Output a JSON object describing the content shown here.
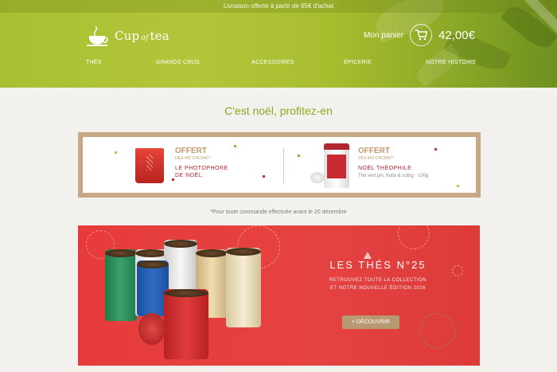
{
  "topbar": {
    "text": "Livraison offerte à partir de 65€ d'achat"
  },
  "corner_ribbon": "",
  "header": {
    "logo": {
      "name": "Cup",
      "connector": "of",
      "tea": "tea"
    },
    "cart": {
      "label": "Mon panier",
      "total": "42,00€"
    }
  },
  "nav": [
    "THÉS",
    "GRANDS CRUS",
    "ACCESSOIRES",
    "ÉPICERIE",
    "NOTRE HISTOIRE"
  ],
  "headline": "C'est noël, profitez-en",
  "promo": {
    "left": {
      "title": "OFFERT",
      "sub": "DÈS 45€ D'ACHAT*",
      "name_line1": "LE PHOTOPHORE",
      "name_line2": "DE NOËL"
    },
    "right": {
      "title": "OFFERT",
      "sub": "DÈS 85€ D'ACHAT*",
      "name": "NOËL THÉOPHILE",
      "desc": "Thé vert pin, fruits & coing · 100g"
    }
  },
  "footnote": "*Pour toute commande effectuée avant le 20 décembre",
  "banner": {
    "title": "LES THÉS N°25",
    "subtitle_line1": "RETROUVEZ TOUTE LA COLLECTION",
    "subtitle_line2": "ET NOTRE NOUVELLE ÉDITION 2016",
    "button": "> DÉCOUVRIR"
  },
  "colors": {
    "accent_green": "#8aab1f",
    "promo_border": "#c7a884",
    "banner_red": "#e54242",
    "button_gold": "#b79a73"
  }
}
